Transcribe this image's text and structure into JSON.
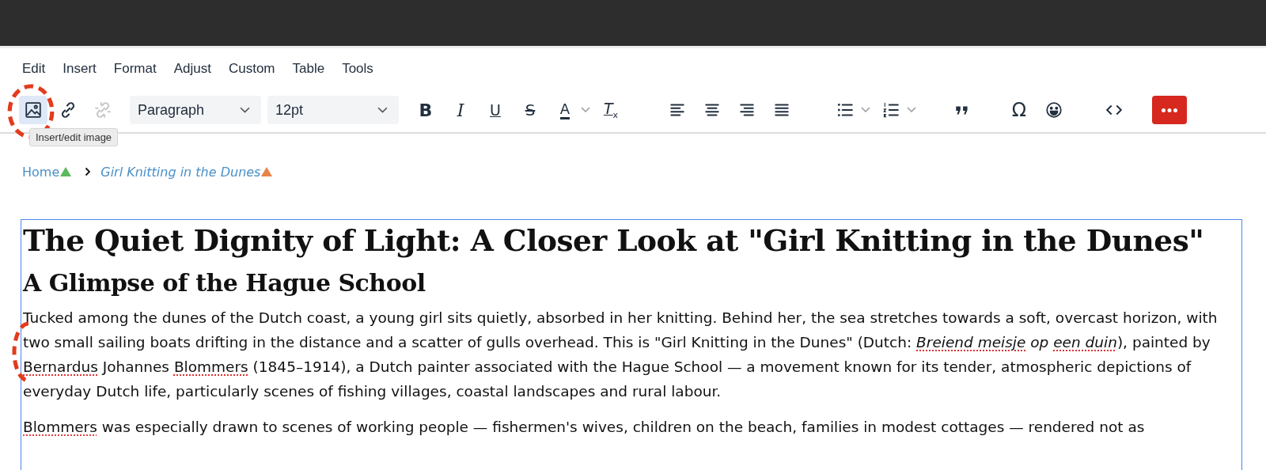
{
  "menu": [
    "Edit",
    "Insert",
    "Format",
    "Adjust",
    "Custom",
    "Table",
    "Tools"
  ],
  "toolbar": [
    [
      {
        "kind": "image",
        "selected": true
      },
      {
        "kind": "link",
        "selected": false
      },
      {
        "kind": "unlink",
        "disabled": true
      }
    ],
    [
      {
        "kind": "select",
        "value": "Paragraph"
      },
      {
        "kind": "select",
        "value": "12pt"
      }
    ],
    [
      {
        "kind": "bold",
        "text": "B"
      },
      {
        "kind": "italic",
        "text": "I"
      },
      {
        "kind": "underline",
        "text": "U"
      },
      {
        "kind": "strike",
        "text": "S"
      },
      {
        "kind": "color",
        "text": "A"
      },
      {
        "kind": "clear",
        "text": "T",
        "sub": "x"
      }
    ],
    [
      {
        "kind": "align-left"
      },
      {
        "kind": "align-center"
      },
      {
        "kind": "align-right"
      },
      {
        "kind": "justify"
      }
    ],
    [
      {
        "kind": "bullets"
      },
      {
        "kind": "numbers"
      }
    ],
    [
      {
        "kind": "quote"
      }
    ],
    [
      {
        "kind": "omega",
        "text": "Ω"
      },
      {
        "kind": "emoji"
      }
    ],
    [
      {
        "kind": "code"
      }
    ],
    [
      {
        "kind": "more"
      }
    ]
  ],
  "tooltip": "Insert/edit image",
  "breadcrumb": [
    {
      "text": "Home",
      "color": "#5cb85c"
    },
    {
      "text": "Girl Knitting in the Dunes",
      "color": "#e8834a"
    }
  ],
  "title": "The Quiet Dignity of Light: A Closer Look at \"Girl Knitting in the Dunes\"",
  "subtitle": "A Glimpse of the Hague School",
  "paragraphs": [
    [
      {
        "text": "Tucked among the dunes of the Dutch coast, a young girl sits quietly, absorbed in her knitting. Behind her, the sea stretches towards a soft, overcast horizon, with two small sailing boats drifting in the distance and a scatter of gulls overhead. This is \"Girl Knitting in the Dunes\" (Dutch: "
      },
      {
        "text": "Breiend meisje",
        "italic": true,
        "misspelled": true
      },
      {
        "text": " op ",
        "italic": true
      },
      {
        "text": "een duin",
        "italic": true,
        "misspelled": true
      },
      {
        "text": "), painted by "
      },
      {
        "text": "Bernardus",
        "misspelled": true
      },
      {
        "text": " Johannes "
      },
      {
        "text": "Blommers",
        "misspelled": true
      },
      {
        "text": " (1845–1914), a Dutch painter associated with the Hague School — a movement known for its tender, atmospheric depictions of everyday Dutch life, particularly scenes of fishing villages, coastal landscapes and rural labour."
      }
    ],
    [
      {
        "text": "Blommers",
        "misspelled": true
      },
      {
        "text": " was especially drawn to scenes of working people — fishermen's wives, children on the beach, families in modest cottages — rendered not as"
      }
    ]
  ]
}
